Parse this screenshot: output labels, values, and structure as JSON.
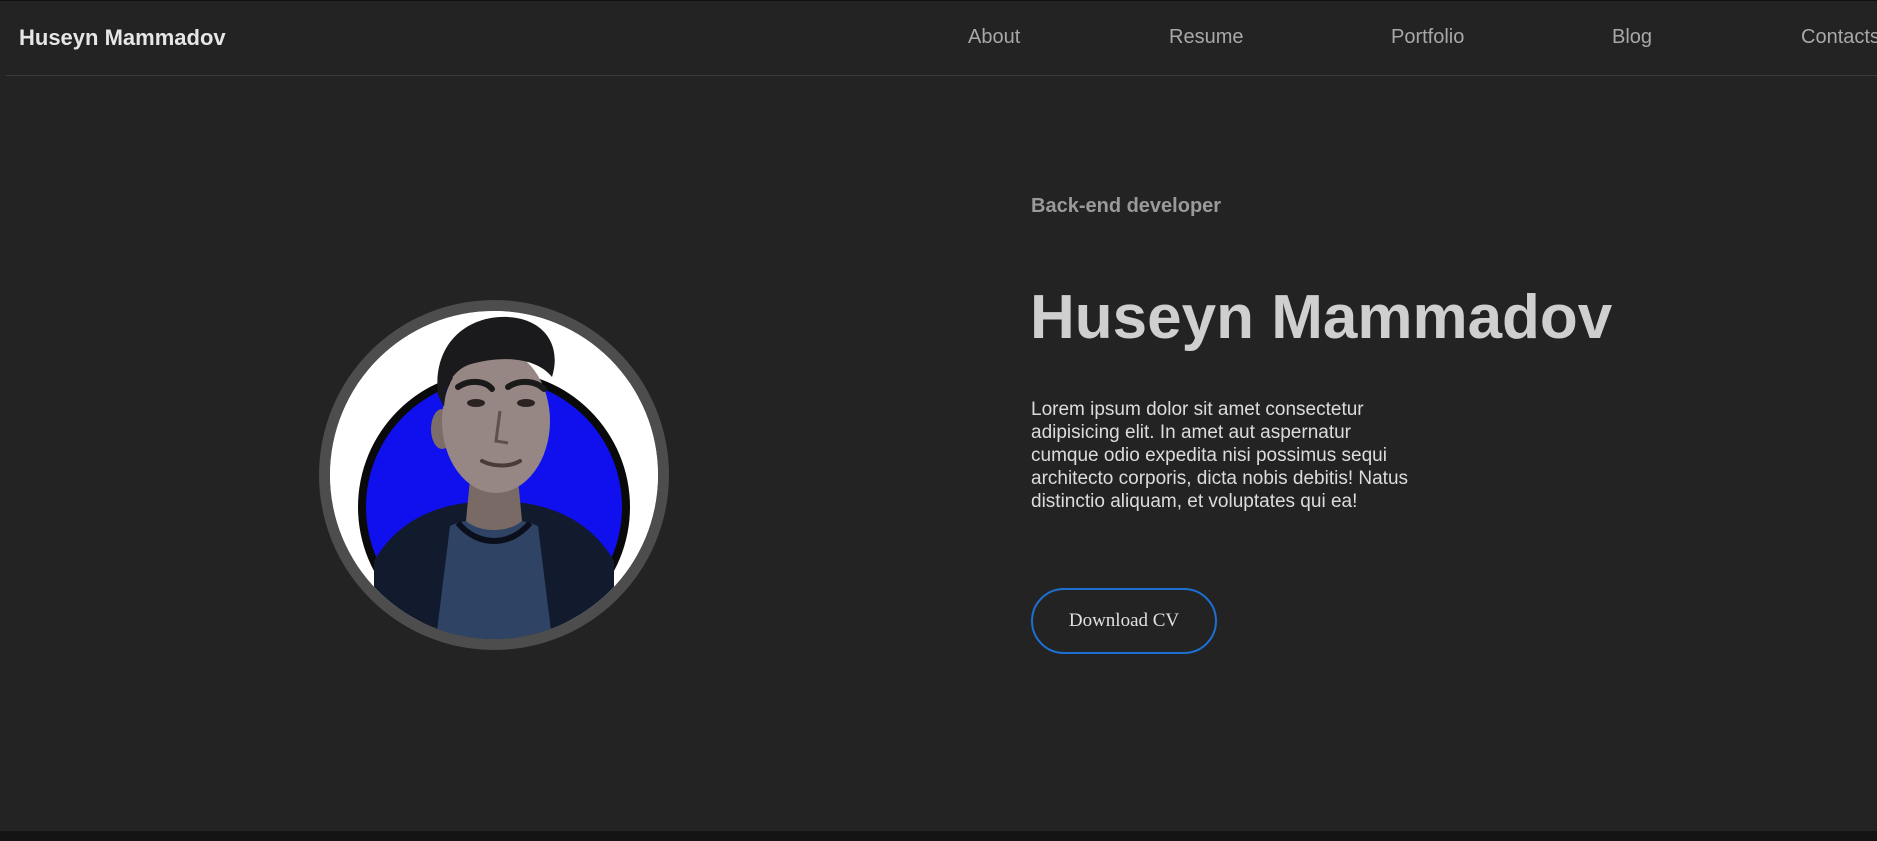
{
  "header": {
    "brand": "Huseyn Mammadov",
    "nav": [
      {
        "label": "About"
      },
      {
        "label": "Resume"
      },
      {
        "label": "Portfolio"
      },
      {
        "label": "Blog"
      },
      {
        "label": "Contacts"
      }
    ]
  },
  "hero": {
    "role": "Back-end developer",
    "name": "Huseyn Mammadov",
    "bio": "Lorem ipsum dolor sit amet consectetur adipisicing elit. In amet aut aspernatur cumque odio expedita nisi possimus sequi architecto corporis, dicta nobis debitis! Natus distinctio aliquam, et voluptates qui ea!",
    "cv_button": "Download CV"
  },
  "colors": {
    "background": "#232323",
    "accent_border": "#1d6fd1",
    "portrait_ring": "#4d4d4d",
    "portrait_blue": "#1010ee"
  }
}
